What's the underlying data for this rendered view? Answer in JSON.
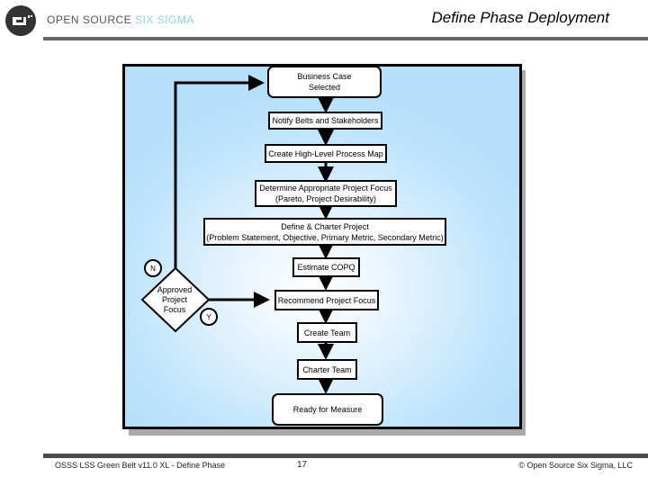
{
  "header": {
    "brand_main": "OPEN SOURCE ",
    "brand_accent": "SIX SIGMA",
    "title": "Define Phase Deployment",
    "logo_icon": "oss-logo-icon"
  },
  "colors": {
    "panel_background": "#b6e0fa",
    "brand_accent": "#8fd0ea",
    "bar": "#666666"
  },
  "flowchart": {
    "nodes": {
      "business_case": "Business Case\nSelected",
      "notify": "Notify Belts and Stakeholders",
      "process_map": "Create High-Level Process Map",
      "project_focus": "Determine Appropriate Project Focus\n(Pareto, Project Desirability)",
      "define_charter": "Define & Charter Project\n(Problem Statement, Objective, Primary Metric, Secondary Metric)",
      "copq": "Estimate COPQ",
      "recommend": "Recommend Project Focus",
      "decision": "Approved\nProject\nFocus",
      "create_team": "Create Team",
      "charter_team": "Charter Team",
      "ready": "Ready for Measure"
    },
    "labels": {
      "no": "N",
      "yes": "Y"
    }
  },
  "footer": {
    "course": "OSSS LSS Green Belt v11.0 XL - Define Phase",
    "page": "17",
    "copyright": "© Open Source Six Sigma, LLC"
  }
}
